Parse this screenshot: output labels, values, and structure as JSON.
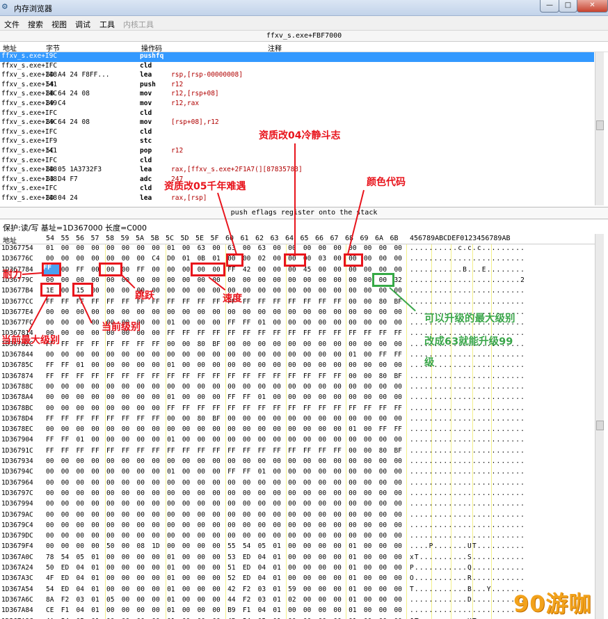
{
  "window": {
    "title": "内存浏览器",
    "icon": "gear-icon",
    "min_label": "—",
    "max_label": "□",
    "close_label": "✕"
  },
  "menu": [
    "文件",
    "搜索",
    "视图",
    "调试",
    "工具",
    "内核工具"
  ],
  "disassembler": {
    "address_bar": "ffxv_s.exe+FBF7000",
    "headers": {
      "address": "地址",
      "bytes": "字节",
      "opcode": "操作码",
      "comment": "注释"
    },
    "rows": [
      {
        "addr": "ffxv_s.exe+I9C",
        "bytes": "",
        "op": "pushfq",
        "args": ""
      },
      {
        "addr": "ffxv_s.exe+IFC",
        "bytes": "",
        "op": "cld",
        "args": ""
      },
      {
        "addr": "ffxv_s.exe+I48",
        "bytes": "8D A4 24 F8FF...",
        "op": "lea",
        "args": "rsp,[rsp-00000008]"
      },
      {
        "addr": "ffxv_s.exe+I41",
        "bytes": "54",
        "op": "push",
        "args": "r12"
      },
      {
        "addr": "ffxv_s.exe+I4C",
        "bytes": "8B 64 24 08",
        "op": "mov",
        "args": "r12,[rsp+08]"
      },
      {
        "addr": "ffxv_s.exe+I49",
        "bytes": "89 C4",
        "op": "mov",
        "args": "r12,rax"
      },
      {
        "addr": "ffxv_s.exe+IFC",
        "bytes": "",
        "op": "cld",
        "args": ""
      },
      {
        "addr": "ffxv_s.exe+I4C",
        "bytes": "89 64 24 08",
        "op": "mov",
        "args": "[rsp+08],r12"
      },
      {
        "addr": "ffxv_s.exe+IFC",
        "bytes": "",
        "op": "cld",
        "args": ""
      },
      {
        "addr": "ffxv_s.exe+IF9",
        "bytes": "",
        "op": "stc",
        "args": ""
      },
      {
        "addr": "ffxv_s.exe+I41",
        "bytes": "5C",
        "op": "pop",
        "args": "r12"
      },
      {
        "addr": "ffxv_s.exe+IFC",
        "bytes": "",
        "op": "cld",
        "args": ""
      },
      {
        "addr": "ffxv_s.exe+I48",
        "bytes": "8D 05 1A3732F3",
        "op": "lea",
        "args": "rax,[ffxv_s.exe+2F1A7(][87835783]"
      },
      {
        "addr": "ffxv_s.exe+I48",
        "bytes": "83 D4 F7",
        "op": "adc",
        "args": "            247"
      },
      {
        "addr": "ffxv_s.exe+IFC",
        "bytes": "",
        "op": "cld",
        "args": ""
      },
      {
        "addr": "ffxv_s.exe+I48",
        "bytes": "8D 04 24",
        "op": "lea",
        "args": "rax,[rsp]"
      }
    ],
    "status": "push eflags register onto the stack"
  },
  "hex": {
    "protection": "保护:读/写   基址=1D367000  长度=C000",
    "header_addr": "地址",
    "header_cols": [
      "54",
      "55",
      "56",
      "57",
      "58",
      "59",
      "5A",
      "5B",
      "5C",
      "5D",
      "5E",
      "5F",
      "60",
      "61",
      "62",
      "63",
      "64",
      "65",
      "66",
      "67",
      "68",
      "69",
      "6A",
      "6B"
    ],
    "header_ascii": "456789ABCDEF0123456789AB",
    "rows": [
      {
        "addr": "1D367754",
        "bytes": "01 00 00 00 00 00 00 00 01 00 63 00 63 00 63 00 00 00 00 00 00 00 00 00",
        "ascii": "..........c.c.c........."
      },
      {
        "addr": "1D36776C",
        "bytes": "00 00 00 00 00 00 00 C4 D0 01 0B 01 00 00 02 00 00 00 03 00 00 00 00 00",
        "ascii": "........................"
      },
      {
        "addr": "1D367784",
        "bytes": "00 00 FF 00 00 00 FF 00 00 00 00 00 FF 42 00 00 00 45 00 00 00 00 00 00",
        "ascii": "...........B...E........"
      },
      {
        "addr": "1D36779C",
        "bytes": "00 00 00 00 00 00 00 00 00 00 00 00 00 00 00 00 00 00 00 00 00 00 00 32",
        "ascii": ".......................2"
      },
      {
        "addr": "1D3677B4",
        "bytes": "1E 00 15 00 00 00 00 00 00 00 00 00 00 00 00 00 00 00 00 00 00 00 00 00",
        "ascii": "........................"
      },
      {
        "addr": "1D3677CC",
        "bytes": "FF FF FF FF FF FF FF FF FF FF FF FF FF FF FF FF FF FF FF FF 00 00 80 BF",
        "ascii": "........................"
      },
      {
        "addr": "1D3677E4",
        "bytes": "00 00 00 00 00 00 00 00 00 00 00 00 00 00 00 00 00 00 00 00 00 00 00 00",
        "ascii": "........................"
      },
      {
        "addr": "1D3677FC",
        "bytes": "00 00 00 00 00 00 00 00 01 00 00 00 FF FF 01 00 00 00 00 00 00 00 00 00",
        "ascii": "........................"
      },
      {
        "addr": "1D367814",
        "bytes": "00 00 00 00 00 00 00 00 FF FF FF FF FF FF FF FF FF FF FF FF FF FF FF FF",
        "ascii": "........................"
      },
      {
        "addr": "1D36782C",
        "bytes": "FF FF FF FF FF FF FF FF 00 00 80 BF 00 00 00 00 00 00 00 00 00 00 00 00",
        "ascii": "........................"
      },
      {
        "addr": "1D367844",
        "bytes": "00 00 00 00 00 00 00 00 00 00 00 00 00 00 00 00 00 00 00 00 01 00 FF FF",
        "ascii": "........................"
      },
      {
        "addr": "1D36785C",
        "bytes": "FF FF 01 00 00 00 00 00 01 00 00 00 00 00 00 00 00 00 00 00 00 00 00 00",
        "ascii": "........................"
      },
      {
        "addr": "1D367874",
        "bytes": "FF FF FF FF FF FF FF FF FF FF FF FF FF FF FF FF FF FF FF FF 00 00 80 BF",
        "ascii": "........................"
      },
      {
        "addr": "1D36788C",
        "bytes": "00 00 00 00 00 00 00 00 00 00 00 00 00 00 00 00 00 00 00 00 00 00 00 00",
        "ascii": "........................"
      },
      {
        "addr": "1D3678A4",
        "bytes": "00 00 00 00 00 00 00 00 01 00 00 00 FF FF 01 00 00 00 00 00 00 00 00 00",
        "ascii": "........................"
      },
      {
        "addr": "1D3678BC",
        "bytes": "00 00 00 00 00 00 00 00 FF FF FF FF FF FF FF FF FF FF FF FF FF FF FF FF",
        "ascii": "........................"
      },
      {
        "addr": "1D3678D4",
        "bytes": "FF FF FF FF FF FF FF FF 00 00 80 BF 00 00 00 00 00 00 00 00 00 00 00 00",
        "ascii": "........................"
      },
      {
        "addr": "1D3678EC",
        "bytes": "00 00 00 00 00 00 00 00 00 00 00 00 00 00 00 00 00 00 00 00 01 00 FF FF",
        "ascii": "........................"
      },
      {
        "addr": "1D367904",
        "bytes": "FF FF 01 00 00 00 00 00 01 00 00 00 00 00 00 00 00 00 00 00 00 00 00 00",
        "ascii": "........................"
      },
      {
        "addr": "1D36791C",
        "bytes": "FF FF FF FF FF FF FF FF FF FF FF FF FF FF FF FF FF FF FF FF 00 00 80 BF",
        "ascii": "........................"
      },
      {
        "addr": "1D367934",
        "bytes": "00 00 00 00 00 00 00 00 00 00 00 00 00 00 00 00 00 00 00 00 00 00 00 00",
        "ascii": "........................"
      },
      {
        "addr": "1D36794C",
        "bytes": "00 00 00 00 00 00 00 00 01 00 00 00 FF FF 01 00 00 00 00 00 00 00 00 00",
        "ascii": "........................"
      },
      {
        "addr": "1D367964",
        "bytes": "00 00 00 00 00 00 00 00 00 00 00 00 00 00 00 00 00 00 00 00 00 00 00 00",
        "ascii": "........................"
      },
      {
        "addr": "1D36797C",
        "bytes": "00 00 00 00 00 00 00 00 00 00 00 00 00 00 00 00 00 00 00 00 00 00 00 00",
        "ascii": "........................"
      },
      {
        "addr": "1D367994",
        "bytes": "00 00 00 00 00 00 00 00 00 00 00 00 00 00 00 00 00 00 00 00 00 00 00 00",
        "ascii": "........................"
      },
      {
        "addr": "1D3679AC",
        "bytes": "00 00 00 00 00 00 00 00 00 00 00 00 00 00 00 00 00 00 00 00 00 00 00 00",
        "ascii": "........................"
      },
      {
        "addr": "1D3679C4",
        "bytes": "00 00 00 00 00 00 00 00 00 00 00 00 00 00 00 00 00 00 00 00 00 00 00 00",
        "ascii": "........................"
      },
      {
        "addr": "1D3679DC",
        "bytes": "00 00 00 00 00 00 00 00 00 00 00 00 00 00 00 00 00 00 00 00 00 00 00 00",
        "ascii": "........................"
      },
      {
        "addr": "1D3679F4",
        "bytes": "00 00 00 00 50 00 08 1D 00 00 00 00 55 54 05 01 00 00 00 00 01 00 00 00",
        "ascii": "....P.......UT.........."
      },
      {
        "addr": "1D367A0C",
        "bytes": "78 54 05 01 00 00 00 00 01 00 00 00 53 ED 04 01 00 00 00 00 01 00 00 00",
        "ascii": "xT..........S..........."
      },
      {
        "addr": "1D367A24",
        "bytes": "50 ED 04 01 00 00 00 00 01 00 00 00 51 ED 04 01 00 00 00 00 01 00 00 00",
        "ascii": "P...........Q..........."
      },
      {
        "addr": "1D367A3C",
        "bytes": "4F ED 04 01 00 00 00 00 01 00 00 00 52 ED 04 01 00 00 00 00 01 00 00 00",
        "ascii": "O...........R..........."
      },
      {
        "addr": "1D367A54",
        "bytes": "54 ED 04 01 00 00 00 00 01 00 00 00 42 F2 03 01 59 00 00 00 01 00 00 00",
        "ascii": "T...........B...Y......."
      },
      {
        "addr": "1D367A6C",
        "bytes": "8A F2 03 01 05 00 00 00 01 00 00 00 44 F2 03 01 02 00 00 00 01 00 00 00",
        "ascii": "............D..........."
      },
      {
        "addr": "1D367A84",
        "bytes": "CE F1 04 01 00 00 00 00 01 00 00 00 B9 F1 04 01 00 00 00 00 01 00 00 00",
        "ascii": "........................"
      },
      {
        "addr": "1D367A9C",
        "bytes": "4A 54 05 01 00 00 00 00 01 00 00 00 4B 54 05 01 00 00 00 00 01 00 00 00",
        "ascii": "JT..........KT.........."
      },
      {
        "addr": "1D367AB4",
        "bytes": "4C 54 05 01 00 00 00 00 01 00 00 00 4D 54 05 01 00 00 00 00 01 00 00 00",
        "ascii": "LT..........MT.........."
      }
    ]
  },
  "annotations": {
    "stamina": "耐力",
    "jump": "跳跃",
    "speed": "速度",
    "current_max_level": "当前最大级别",
    "current_level": "当前级别",
    "aptitude_05": "资质改05千年难遇",
    "aptitude_04": "资质改04冷静斗志",
    "color_code": "颜色代码",
    "max_level_note_1": "可以升级的最大级别",
    "max_level_note_2": "改成63就能升级99",
    "max_level_note_3": "级",
    "marked_ff1": "FF",
    "marked_ff2": "FF",
    "marked_ff42": "FF 42",
    "marked_01": "01",
    "marked_02": "02",
    "marked_03": "03",
    "marked_32": "32",
    "marked_1e": "1E",
    "marked_15": "15"
  },
  "watermark": "90游咖",
  "colors": {
    "selection": "#3399ff",
    "annotation_red": "#e8141c",
    "annotation_green": "#3aa64a",
    "watermark": "#f2a21b"
  }
}
